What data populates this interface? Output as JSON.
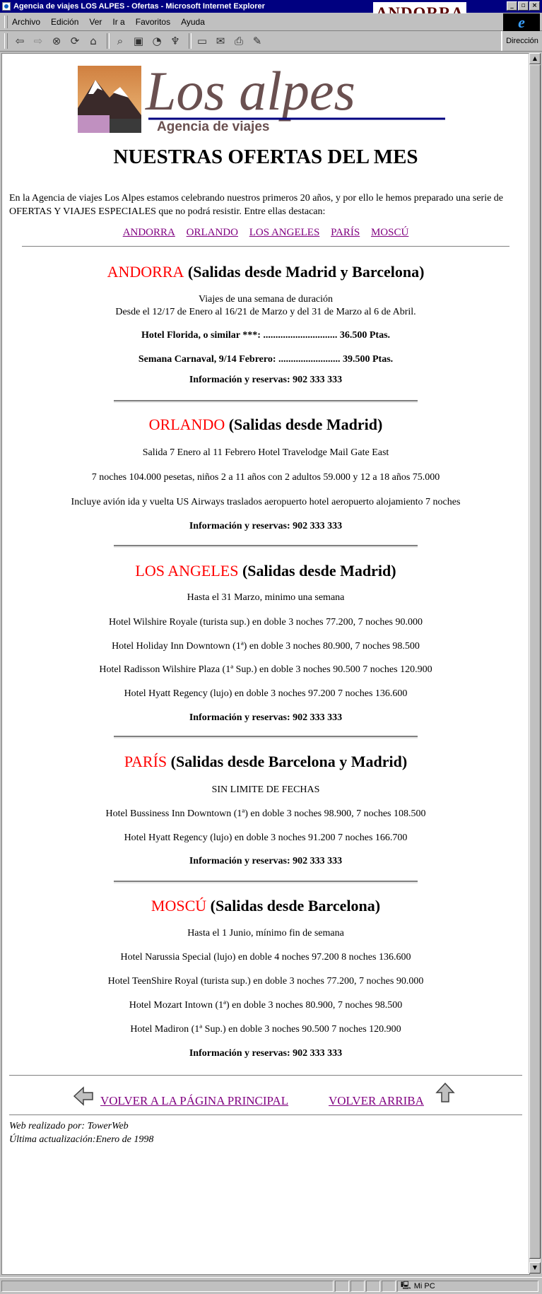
{
  "window": {
    "title": "Agencia de viajes LOS ALPES - Ofertas - Microsoft Internet Explorer",
    "brand_badge": "ANDORRA",
    "buttons": {
      "minimize": "_",
      "maximize": "▫",
      "close": "×"
    }
  },
  "menubar": {
    "items": [
      "Archivo",
      "Edición",
      "Ver",
      "Ir a",
      "Favoritos",
      "Ayuda"
    ]
  },
  "toolbar": {
    "icons": [
      "back-icon",
      "forward-icon",
      "stop-icon",
      "refresh-icon",
      "home-icon",
      "search-icon",
      "favorites-icon",
      "history-icon",
      "channels-icon",
      "fullscreen-icon",
      "mail-icon",
      "print-icon",
      "edit-icon"
    ],
    "address_label": "Dirección"
  },
  "page": {
    "logo": {
      "title": "Los alpes",
      "subtitle": "Agencia de viajes"
    },
    "heading": "NUESTRAS OFERTAS DEL MES",
    "intro": "En la Agencia de viajes Los Alpes estamos celebrando nuestros primeros 20 años, y por ello le hemos preparado una serie de OFERTAS Y VIAJES ESPECIALES que no podrá resistir. Entre ellas destacan:",
    "nav_links": [
      "ANDORRA",
      "ORLANDO",
      "LOS ANGELES",
      "PARÍS",
      "MOSCÚ"
    ],
    "info_label": "Información y reservas: 902 333 333",
    "sections": [
      {
        "dest": "ANDORRA",
        "dep": "(Salidas desde Madrid y Barcelona)",
        "lines": [
          "Viajes de una semana de duración",
          "Desde el 12/17 de Enero al 16/21 de Marzo y del 31 de Marzo al 6 de Abril.",
          "Hotel Florida, o similar ***: .............................. 36.500 Ptas.",
          "Semana Carnaval, 9/14 Febrero: ......................... 39.500 Ptas."
        ]
      },
      {
        "dest": "ORLANDO",
        "dep": "(Salidas desde Madrid)",
        "lines": [
          "Salida 7 Enero al 11 Febrero Hotel Travelodge Mail Gate East",
          "7 noches 104.000 pesetas, niños 2 a 11 años con 2 adultos 59.000 y 12 a 18 años 75.000",
          "Incluye avión ida y vuelta US Airways traslados aeropuerto hotel aeropuerto alojamiento 7 noches"
        ]
      },
      {
        "dest": "LOS ANGELES",
        "dep": "(Salidas desde Madrid)",
        "lines": [
          "Hasta el 31 Marzo, minimo una semana",
          "Hotel Wilshire Royale (turista sup.) en doble 3 noches 77.200, 7 noches 90.000",
          "Hotel Holiday Inn Downtown (1ª) en doble 3 noches 80.900, 7 noches 98.500",
          "Hotel Radisson Wilshire Plaza (1ª Sup.) en doble 3 noches 90.500 7 noches 120.900",
          "Hotel Hyatt Regency (lujo) en doble 3 noches 97.200 7 noches 136.600"
        ]
      },
      {
        "dest": "PARÍS",
        "dep": "(Salidas desde Barcelona y Madrid)",
        "lines": [
          "SIN LIMITE DE FECHAS",
          "Hotel Bussiness Inn Downtown (1ª) en doble 3 noches 98.900, 7 noches 108.500",
          "Hotel Hyatt Regency (lujo) en doble 3 noches 91.200 7 noches 166.700"
        ]
      },
      {
        "dest": "MOSCÚ",
        "dep": "(Salidas desde Barcelona)",
        "lines": [
          "Hasta el 1 Junio, mínimo fin de semana",
          "Hotel Narussia Special (lujo) en doble 4 noches 97.200 8 noches 136.600",
          "Hotel TeenShire Royal (turista sup.) en doble 3 noches 77.200, 7 noches 90.000",
          "Hotel Mozart Intown (1ª) en doble 3 noches 80.900, 7 noches 98.500",
          "Hotel Madiron (1ª Sup.) en doble 3 noches 90.500 7 noches 120.900"
        ]
      }
    ],
    "footer": {
      "back_link": "VOLVER A LA PÁGINA PRINCIPAL",
      "top_link": "VOLVER ARRIBA",
      "credit": "Web realizado por: TowerWeb",
      "updated": "Última actualización:Enero de 1998"
    }
  },
  "statusbar": {
    "zone": "Mi PC"
  },
  "colors": {
    "titlebar": "#000080",
    "link_visited": "#800080",
    "destination": "#ff0000",
    "brand": "#5a0000"
  }
}
